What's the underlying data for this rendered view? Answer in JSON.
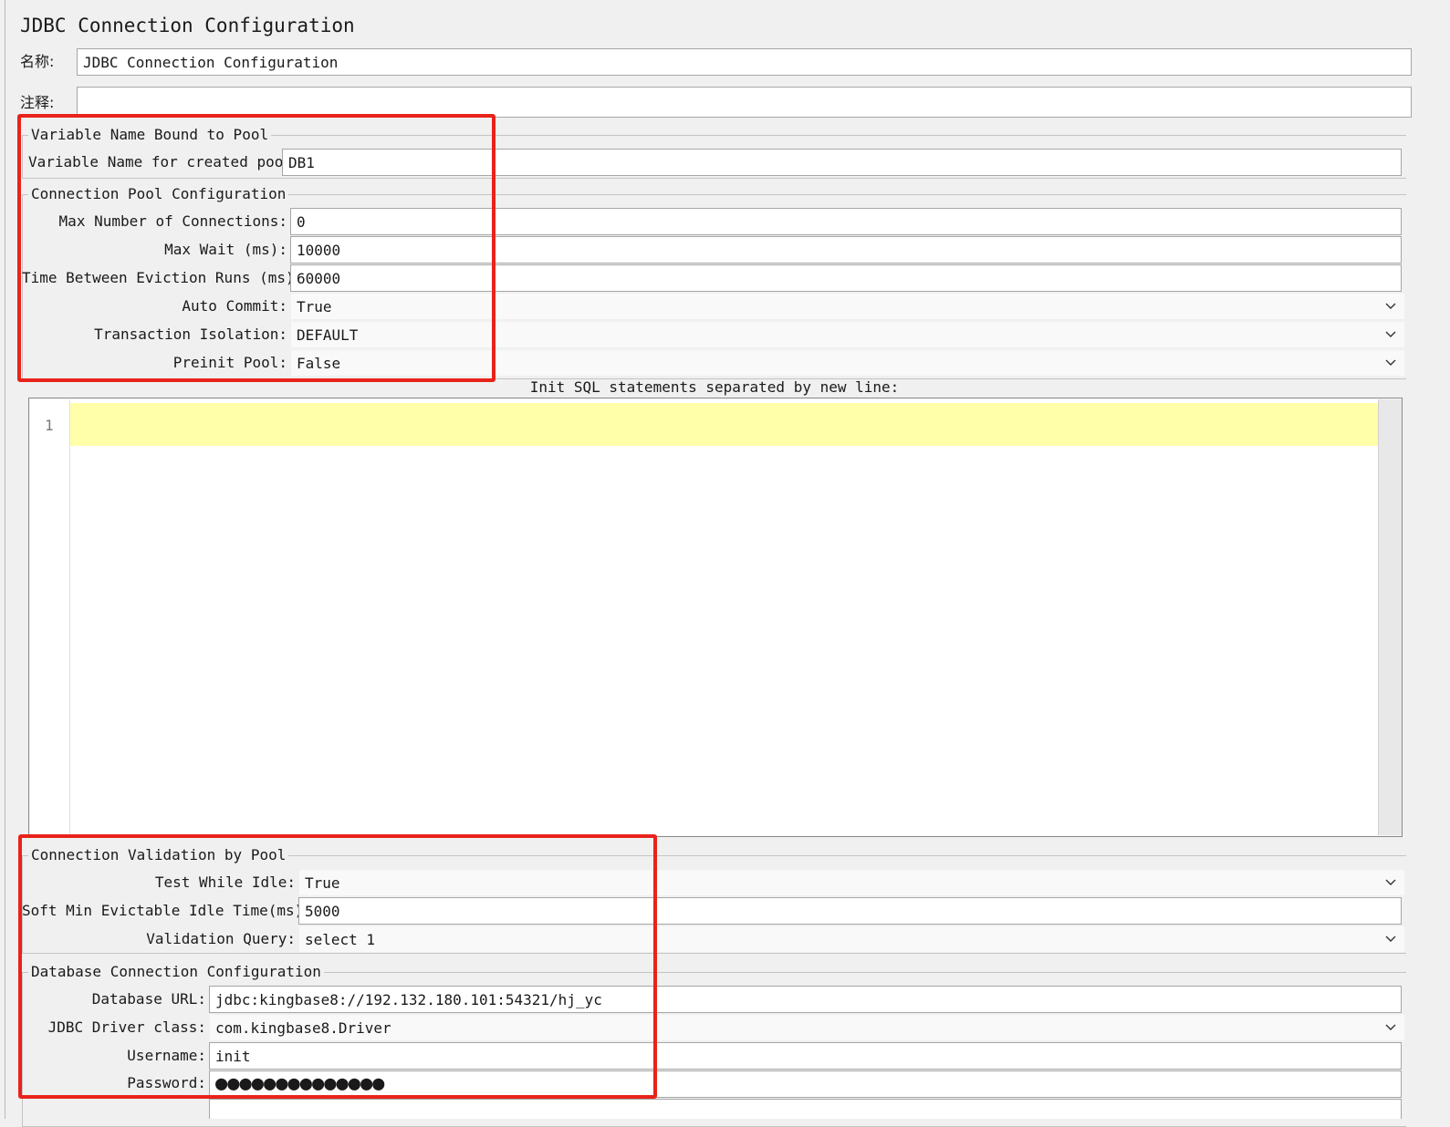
{
  "title": "JDBC Connection Configuration",
  "name_row": {
    "label": "名称:",
    "value": "JDBC Connection Configuration"
  },
  "comment_row": {
    "label": "注释:",
    "value": ""
  },
  "variable_section": {
    "legend": "Variable Name Bound to Pool",
    "pool_label": "Variable Name for created pool:",
    "pool_value": "DB1"
  },
  "pool_section": {
    "legend": "Connection Pool Configuration",
    "max_connections": {
      "label": "Max Number of Connections:",
      "value": "0"
    },
    "max_wait": {
      "label": "Max Wait (ms):",
      "value": "10000"
    },
    "eviction": {
      "label": "Time Between Eviction Runs (ms):",
      "value": "60000"
    },
    "auto_commit": {
      "label": "Auto Commit:",
      "value": "True"
    },
    "isolation": {
      "label": "Transaction Isolation:",
      "value": "DEFAULT"
    },
    "preinit": {
      "label": "Preinit Pool:",
      "value": "False"
    }
  },
  "init_sql": {
    "label": "Init SQL statements separated by new line:",
    "line_number": "1"
  },
  "validation_section": {
    "legend": "Connection Validation by Pool",
    "test_idle": {
      "label": "Test While Idle:",
      "value": "True"
    },
    "soft_min": {
      "label": "Soft Min Evictable Idle Time(ms):",
      "value": "5000"
    },
    "query": {
      "label": "Validation Query:",
      "value": "select 1"
    }
  },
  "database_section": {
    "legend": "Database Connection Configuration",
    "url": {
      "label": "Database URL:",
      "value": "jdbc:kingbase8://192.132.180.101:54321/hj_yc"
    },
    "driver": {
      "label": "JDBC Driver class:",
      "value": "com.kingbase8.Driver"
    },
    "username": {
      "label": "Username:",
      "value": "init"
    },
    "password": {
      "label": "Password:",
      "value": "●●●●●●●●●●●●●●"
    }
  },
  "icons": {
    "dropdown": "chevron-down-icon"
  },
  "colors": {
    "highlight_box": "#e8231b",
    "active_line": "#ffffaa",
    "background": "#f0f0f0"
  }
}
